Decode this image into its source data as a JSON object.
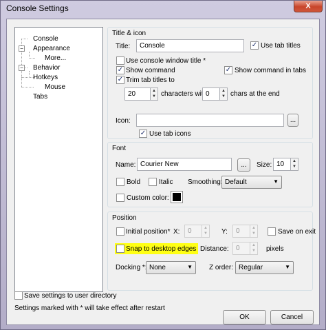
{
  "window": {
    "title": "Console Settings",
    "close_symbol": "X"
  },
  "tree": {
    "items": [
      {
        "label": "Console"
      },
      {
        "label": "Appearance"
      },
      {
        "label": "More..."
      },
      {
        "label": "Behavior"
      },
      {
        "label": "Hotkeys"
      },
      {
        "label": "Mouse"
      },
      {
        "label": "Tabs"
      }
    ]
  },
  "title_icon": {
    "group_label": "Title & icon",
    "title_label": "Title:",
    "title_placeholder": "Console",
    "use_tab_titles": {
      "label": "Use tab titles",
      "checked": true
    },
    "use_console_window_title": {
      "label": "Use console window title *",
      "checked": false
    },
    "show_command": {
      "label": "Show command",
      "checked": true
    },
    "show_command_in_tabs": {
      "label": "Show command in tabs",
      "checked": true
    },
    "trim_tab_titles": {
      "label": "Trim tab titles to",
      "checked": true
    },
    "trim_count": "20",
    "characters_with_label": "characters with",
    "chars_at_end_value": "0",
    "chars_at_end_label": "chars at the end",
    "icon_label": "Icon:",
    "browse_label": "...",
    "use_tab_icons": {
      "label": "Use tab icons",
      "checked": true
    }
  },
  "font": {
    "group_label": "Font",
    "name_label": "Name:",
    "name_value": "Courier New",
    "browse_label": "...",
    "size_label": "Size:",
    "size_value": "10",
    "bold": {
      "label": "Bold",
      "checked": false
    },
    "italic": {
      "label": "Italic",
      "checked": false
    },
    "smoothing_label": "Smoothing:",
    "smoothing_value": "Default",
    "custom_color": {
      "label": "Custom color:",
      "checked": false
    },
    "custom_color_value": "#000000"
  },
  "position": {
    "group_label": "Position",
    "initial_position": {
      "label": "Initial position*",
      "checked": false
    },
    "x_label": "X:",
    "x_value": "0",
    "y_label": "Y:",
    "y_value": "0",
    "save_on_exit": {
      "label": "Save on exit",
      "checked": false
    },
    "snap_to_desktop_edges": {
      "label": "Snap to desktop edges",
      "checked": false
    },
    "distance_label": "Distance:",
    "distance_value": "0",
    "pixels_label": "pixels",
    "docking_label": "Docking *:",
    "docking_value": "None",
    "z_order_label": "Z order:",
    "z_order_value": "Regular"
  },
  "footer": {
    "save_to_user_dir": {
      "label": "Save settings to user directory",
      "checked": false
    },
    "restart_note": "Settings marked with * will take effect after restart",
    "ok_label": "OK",
    "cancel_label": "Cancel"
  },
  "colors": {
    "highlight": "#ffff14",
    "checkmark": "#1d2f6c"
  }
}
